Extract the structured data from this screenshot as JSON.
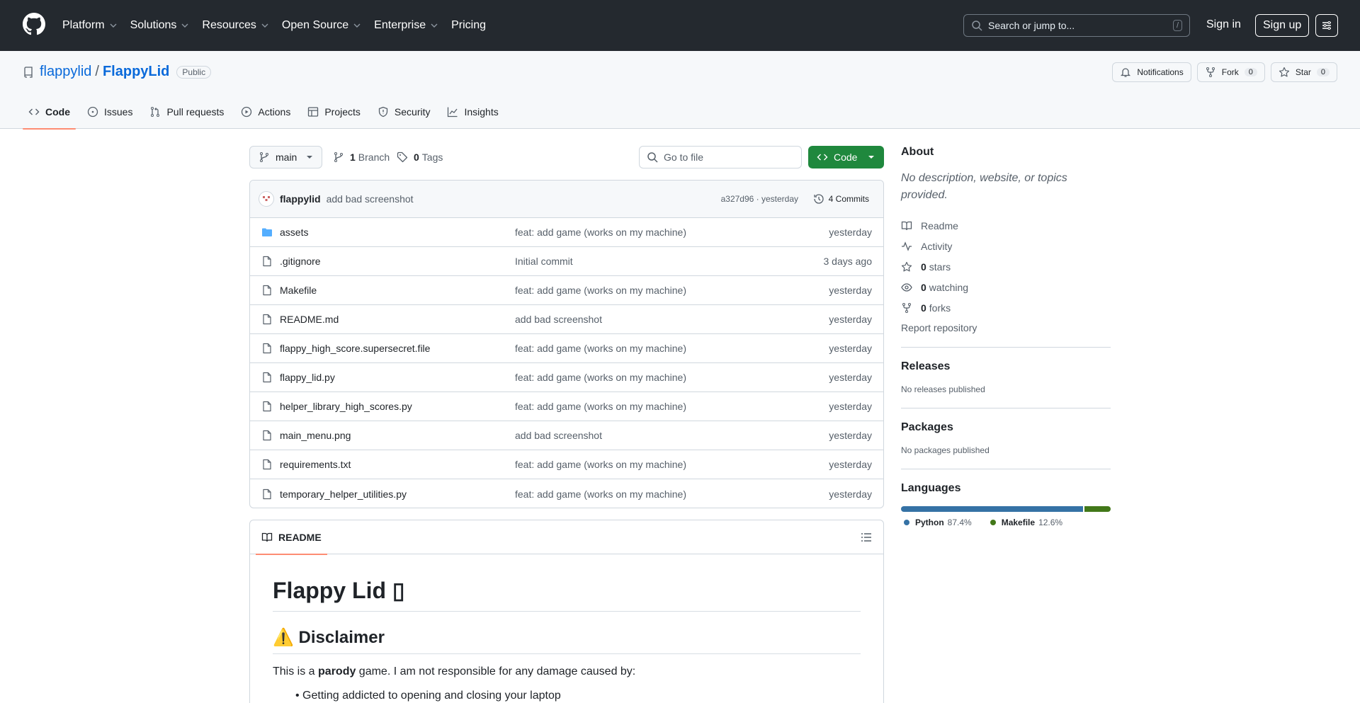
{
  "header": {
    "nav": [
      "Platform",
      "Solutions",
      "Resources",
      "Open Source",
      "Enterprise",
      "Pricing"
    ],
    "nav_has_chevron": [
      true,
      true,
      true,
      true,
      true,
      false
    ],
    "search_placeholder": "Search or jump to...",
    "search_shortcut": "/",
    "sign_in": "Sign in",
    "sign_up": "Sign up"
  },
  "repo": {
    "owner": "flappylid",
    "separator": "/",
    "name": "FlappyLid",
    "visibility": "Public",
    "notifications": "Notifications",
    "fork_label": "Fork",
    "fork_count": "0",
    "star_label": "Star",
    "star_count": "0",
    "tabs": [
      "Code",
      "Issues",
      "Pull requests",
      "Actions",
      "Projects",
      "Security",
      "Insights"
    ]
  },
  "toolbar": {
    "branch": "main",
    "branch_count": "1",
    "branch_label": "Branch",
    "tag_count": "0",
    "tag_label": "Tags",
    "goto_placeholder": "Go to file",
    "code_button": "Code"
  },
  "commit": {
    "user": "flappylid",
    "message": "add bad screenshot",
    "meta": "a327d96 · yesterday",
    "count": "4 Commits"
  },
  "files": [
    {
      "name": "assets",
      "type": "folder",
      "message": "feat: add game (works on my machine)",
      "date": "yesterday"
    },
    {
      "name": ".gitignore",
      "type": "file",
      "message": "Initial commit",
      "date": "3 days ago"
    },
    {
      "name": "Makefile",
      "type": "file",
      "message": "feat: add game (works on my machine)",
      "date": "yesterday"
    },
    {
      "name": "README.md",
      "type": "file",
      "message": "add bad screenshot",
      "date": "yesterday"
    },
    {
      "name": "flappy_high_score.supersecret.file",
      "type": "file",
      "message": "feat: add game (works on my machine)",
      "date": "yesterday"
    },
    {
      "name": "flappy_lid.py",
      "type": "file",
      "message": "feat: add game (works on my machine)",
      "date": "yesterday"
    },
    {
      "name": "helper_library_high_scores.py",
      "type": "file",
      "message": "feat: add game (works on my machine)",
      "date": "yesterday"
    },
    {
      "name": "main_menu.png",
      "type": "file",
      "message": "add bad screenshot",
      "date": "yesterday"
    },
    {
      "name": "requirements.txt",
      "type": "file",
      "message": "feat: add game (works on my machine)",
      "date": "yesterday"
    },
    {
      "name": "temporary_helper_utilities.py",
      "type": "file",
      "message": "feat: add game (works on my machine)",
      "date": "yesterday"
    }
  ],
  "readme": {
    "tab": "README",
    "h1": "Flappy Lid ▯",
    "h2": "⚠️ Disclaimer",
    "p_before": "This is a ",
    "p_bold": "parody",
    "p_after": " game. I am not responsible for any damage caused by:",
    "li": "Getting addicted to opening and closing your laptop"
  },
  "about": {
    "title": "About",
    "description": "No description, website, or topics provided.",
    "readme": "Readme",
    "activity": "Activity",
    "stars_count": "0",
    "stars_label": "stars",
    "watching_count": "0",
    "watching_label": "watching",
    "forks_count": "0",
    "forks_label": "forks",
    "report": "Report repository"
  },
  "releases": {
    "title": "Releases",
    "empty": "No releases published"
  },
  "packages": {
    "title": "Packages",
    "empty": "No packages published"
  },
  "languages": {
    "title": "Languages",
    "items": [
      {
        "name": "Python",
        "percent": "87.4%",
        "value": 87.4,
        "color": "#3572A5"
      },
      {
        "name": "Makefile",
        "percent": "12.6%",
        "value": 12.6,
        "color": "#427819"
      }
    ]
  },
  "colors": {
    "accent": "#0969da",
    "header_bg": "#24292f",
    "code_button": "#1f883d",
    "tab_underline": "#fd8c73"
  }
}
